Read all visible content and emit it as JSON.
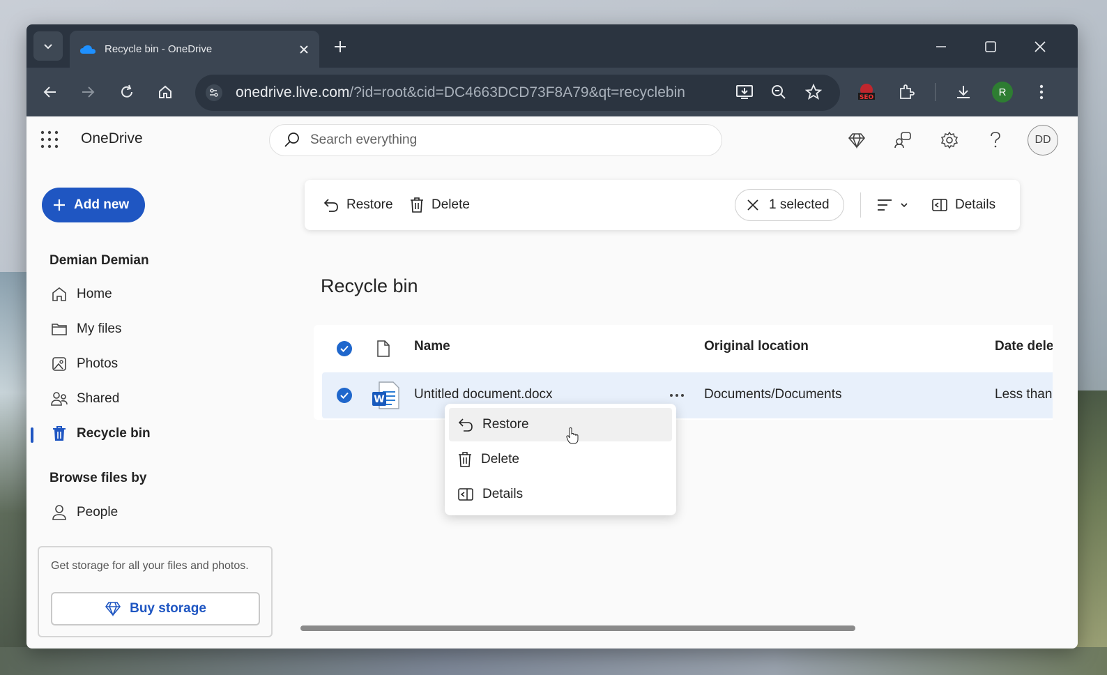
{
  "browser": {
    "tab_title": "Recycle bin - OneDrive",
    "url_host": "onedrive.live.com",
    "url_path": "/?id=root&cid=DC4663DCD73F8A79&qt=recyclebin",
    "profile_initial": "R"
  },
  "app": {
    "brand": "OneDrive",
    "search_placeholder": "Search everything",
    "avatar_initials": "DD"
  },
  "sidebar": {
    "add_new": "Add new",
    "user_name": "Demian Demian",
    "items": [
      {
        "label": "Home"
      },
      {
        "label": "My files"
      },
      {
        "label": "Photos"
      },
      {
        "label": "Shared"
      },
      {
        "label": "Recycle bin"
      }
    ],
    "browse_heading": "Browse files by",
    "browse_items": [
      {
        "label": "People"
      }
    ],
    "storage_text": "Get storage for all your files and photos.",
    "buy_storage": "Buy storage"
  },
  "commandbar": {
    "restore": "Restore",
    "delete": "Delete",
    "selected": "1 selected",
    "details": "Details"
  },
  "page": {
    "title": "Recycle bin"
  },
  "table": {
    "columns": [
      "Name",
      "Original location",
      "Date dele"
    ],
    "rows": [
      {
        "name": "Untitled document.docx",
        "location": "Documents/Documents",
        "date": "Less than",
        "selected": true
      }
    ]
  },
  "context_menu": {
    "items": [
      {
        "label": "Restore"
      },
      {
        "label": "Delete"
      },
      {
        "label": "Details"
      }
    ]
  },
  "colors": {
    "accent": "#1f56c2",
    "selected_row": "#e8f0fb",
    "browser_dark": "#2b3440"
  }
}
